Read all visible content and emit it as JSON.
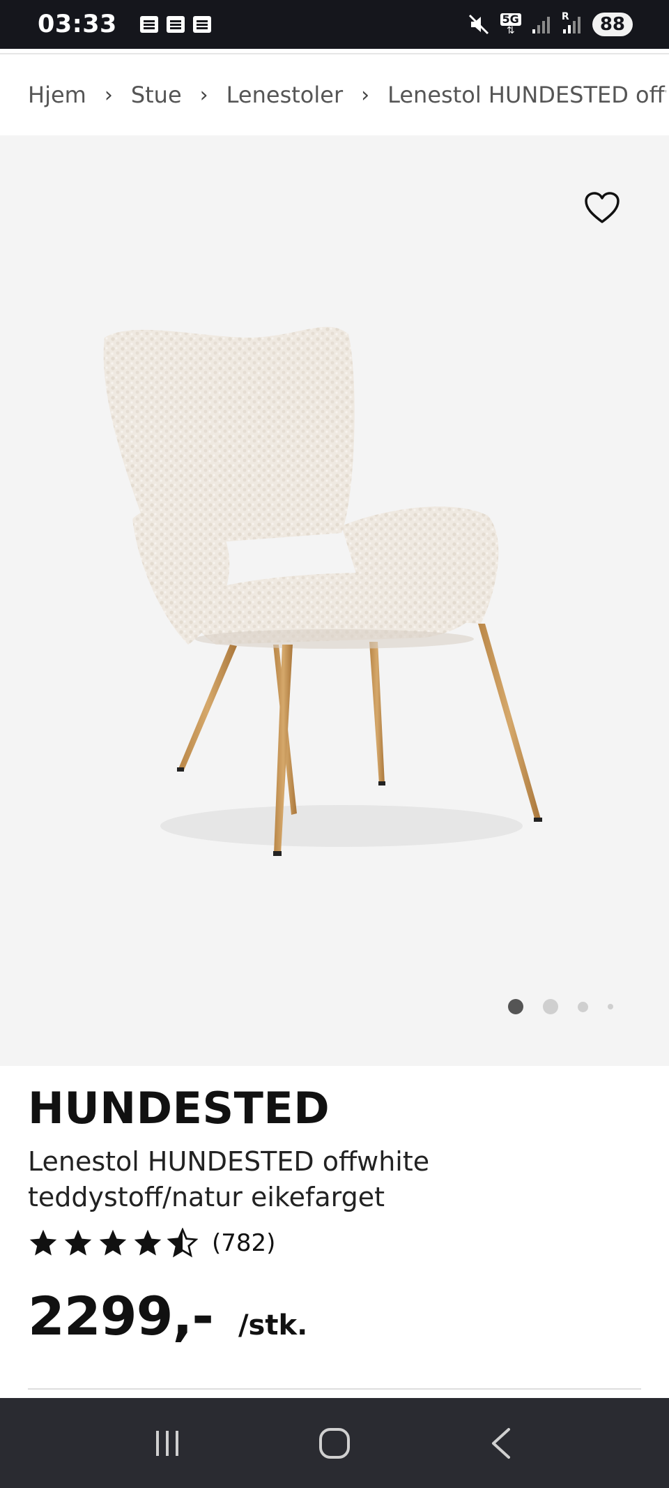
{
  "status_bar": {
    "time": "03:33",
    "notification_icons": [
      "news-icon",
      "news-icon",
      "news-icon"
    ],
    "system_icons": [
      "mute-icon",
      "5g-icon",
      "signal-icon",
      "signal-roaming-icon"
    ],
    "network": "5G",
    "roaming_label": "R",
    "battery": "88"
  },
  "breadcrumb": {
    "items": [
      "Hjem",
      "Stue",
      "Lenestoler",
      "Lenestol HUNDESTED offwhite"
    ],
    "separator": "›"
  },
  "product": {
    "brand": "HUNDESTED",
    "name_line1": "Lenestol HUNDESTED offwhite",
    "name_line2": "teddystoff/natur eikefarget",
    "rating": 4.5,
    "review_count": "(782)",
    "price": "2299,-",
    "unit": "/stk.",
    "image_count": 4,
    "active_image": 0
  },
  "nav_bar": {
    "buttons": [
      "recent-apps",
      "home",
      "back"
    ]
  },
  "colors": {
    "status_bar_bg": "#15161c",
    "hero_bg": "#f4f4f4",
    "nav_bar_bg": "#2a2b31",
    "chair_fabric": "#efe9e1",
    "chair_legs": "#c99b5c"
  }
}
